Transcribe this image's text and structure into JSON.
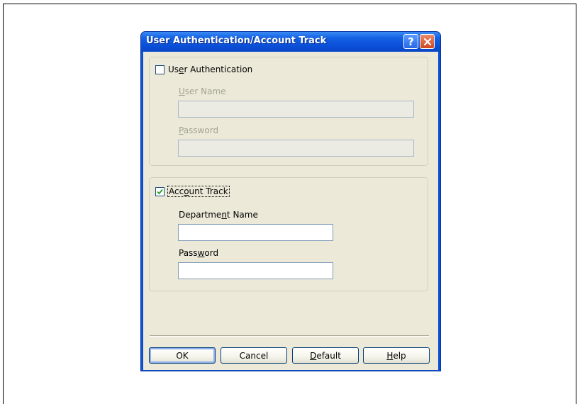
{
  "window": {
    "title": "User Authentication/Account Track",
    "help_icon": "question-mark",
    "close_icon": "x-close"
  },
  "user_auth": {
    "checkbox_label_pre": "Us",
    "checkbox_label_u": "e",
    "checkbox_label_post": "r Authentication",
    "checked": false,
    "user_name_label_u": "U",
    "user_name_label_rest": "ser Name",
    "user_name_value": "",
    "password_label_u": "P",
    "password_label_rest": "assword",
    "password_value": ""
  },
  "account_track": {
    "checkbox_label_pre": "Acc",
    "checkbox_label_u": "o",
    "checkbox_label_post": "unt Track",
    "checked": true,
    "dept_label_pre": "Departme",
    "dept_label_u": "n",
    "dept_label_post": "t Name",
    "dept_value": "",
    "password_label_pre": "Pass",
    "password_label_u": "w",
    "password_label_post": "ord",
    "password_value": ""
  },
  "buttons": {
    "ok": "OK",
    "cancel": "Cancel",
    "default_u": "D",
    "default_rest": "efault",
    "help_u": "H",
    "help_rest": "elp"
  },
  "colors": {
    "titlebar": "#0a4fd8",
    "dialog_face": "#ece9d8",
    "checkmark": "#21a121",
    "close_button": "#d2461d"
  }
}
